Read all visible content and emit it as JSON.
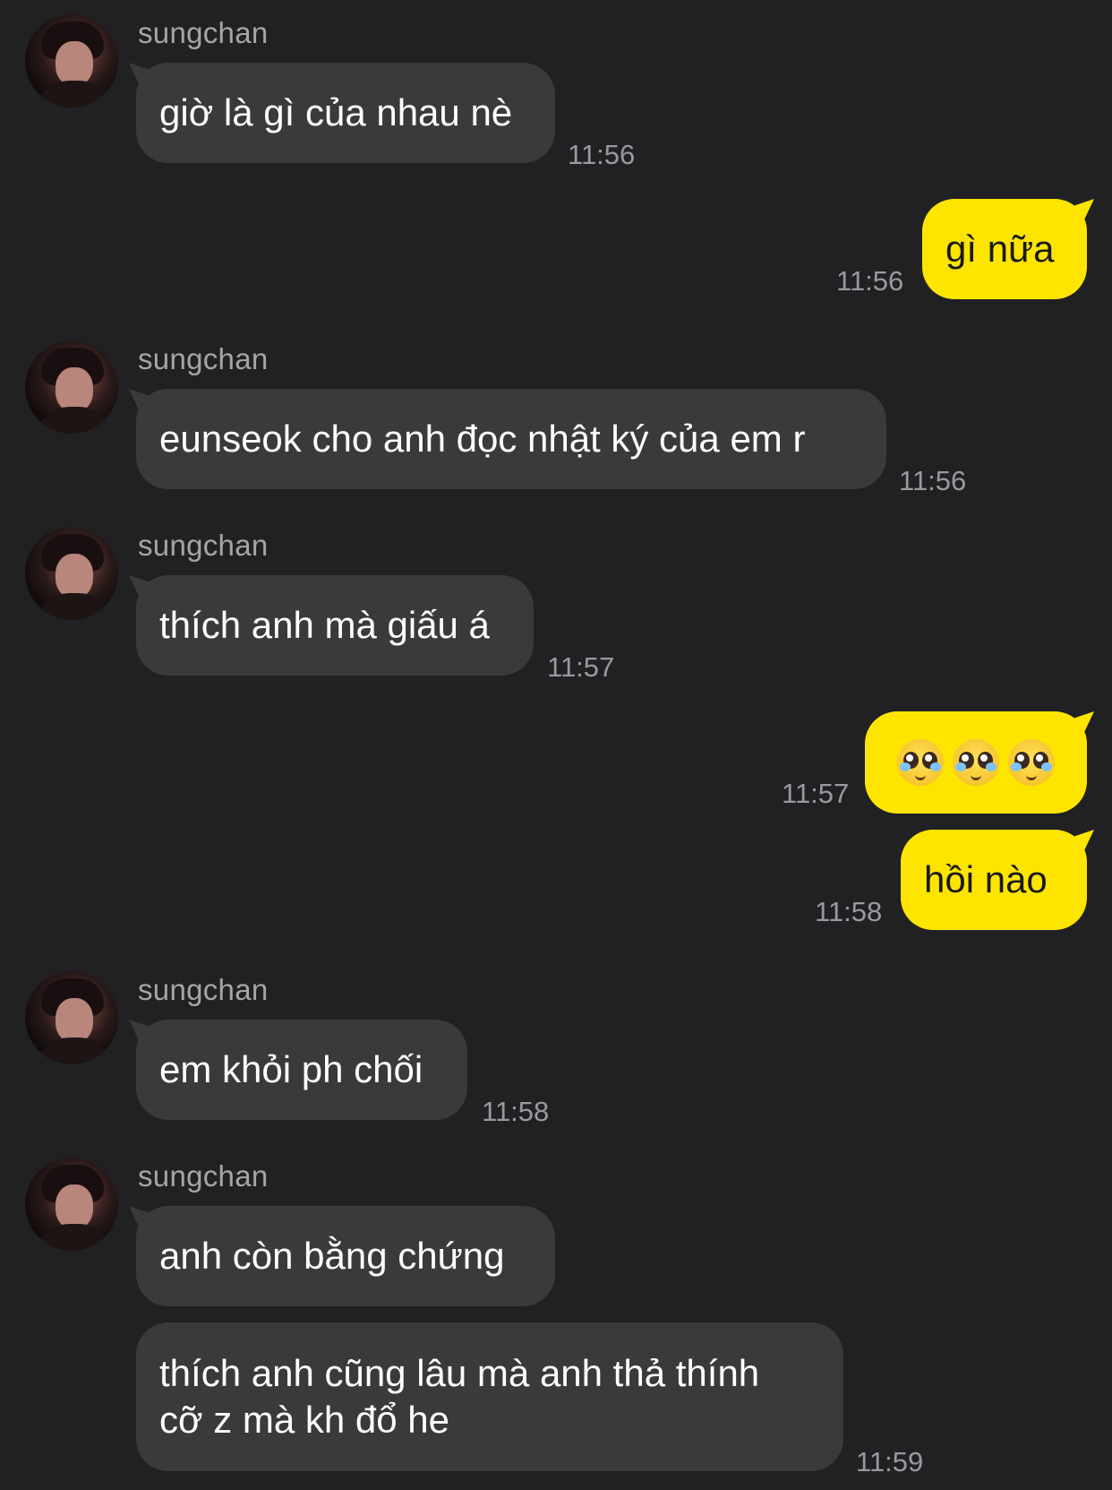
{
  "chat": {
    "messages": [
      {
        "sender": "sungchan",
        "text": "giờ là gì của nhau nè",
        "time": "11:56"
      },
      {
        "text": "gì nữa",
        "time": "11:56"
      },
      {
        "sender": "sungchan",
        "text": "eunseok cho anh đọc nhật ký của em r",
        "time": "11:56"
      },
      {
        "sender": "sungchan",
        "text": "thích anh mà giấu á",
        "time": "11:57"
      },
      {
        "emoji": [
          "pleading-face",
          "pleading-face",
          "pleading-face"
        ],
        "time": "11:57"
      },
      {
        "text": "hồi nào",
        "time": "11:58"
      },
      {
        "sender": "sungchan",
        "text": "em khỏi ph chối",
        "time": "11:58"
      },
      {
        "sender": "sungchan",
        "text": "anh còn bằng chứng"
      },
      {
        "text_line1": "thích anh cũng lâu mà anh thả thính",
        "text_line2": "cỡ z mà kh đổ he",
        "time": "11:59"
      }
    ]
  },
  "colors": {
    "background": "#212124",
    "incoming_bubble": "#3a3a3d",
    "outgoing_bubble": "#fee500",
    "timestamp": "#9a9a9e",
    "sender_name": "#a5a5a8"
  }
}
